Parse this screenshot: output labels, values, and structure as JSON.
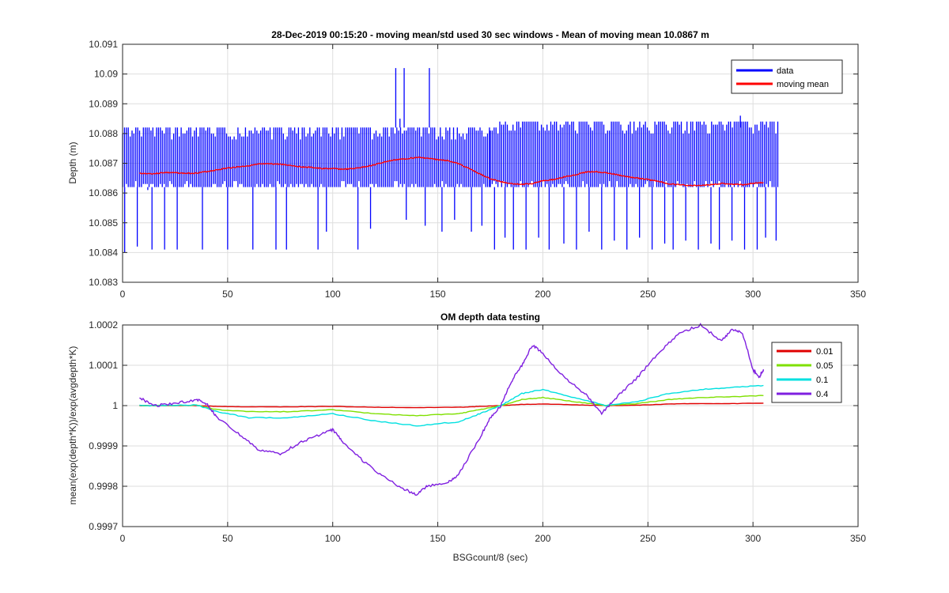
{
  "chart_data": [
    {
      "type": "line",
      "title": "28-Dec-2019 00:15:20 - moving mean/std used 30 sec windows - Mean of moving mean 10.0867 m",
      "xlabel": "",
      "ylabel": "Depth (m)",
      "xlim": [
        0,
        350
      ],
      "ylim": [
        10.083,
        10.091
      ],
      "x_ticks": [
        0,
        50,
        100,
        150,
        200,
        250,
        300,
        350
      ],
      "y_ticks": [
        10.083,
        10.084,
        10.085,
        10.086,
        10.087,
        10.088,
        10.089,
        10.09,
        10.091
      ],
      "y_tick_labels": [
        "10.083",
        "10.084",
        "10.085",
        "10.086",
        "10.087",
        "10.088",
        "10.089",
        "10.09",
        "10.091"
      ],
      "grid": true,
      "legend_position": "top-right",
      "series": [
        {
          "name": "data",
          "color": "#0000ff",
          "kind": "noisy-band",
          "x_range": [
            0,
            312
          ],
          "band_segments": [
            {
              "x": [
                0,
                175
              ],
              "low": 10.0862,
              "high": 10.0882
            },
            {
              "x": [
                175,
                312
              ],
              "low": 10.0862,
              "high": 10.0884
            }
          ],
          "spikes_down": [
            [
              1,
              10.084
            ],
            [
              7,
              10.0842
            ],
            [
              12,
              10.0861
            ],
            [
              14,
              10.0841
            ],
            [
              20,
              10.0841
            ],
            [
              26,
              10.0841
            ],
            [
              38,
              10.0841
            ],
            [
              50,
              10.0841
            ],
            [
              62,
              10.0841
            ],
            [
              73,
              10.0841
            ],
            [
              78,
              10.0841
            ],
            [
              93,
              10.0841
            ],
            [
              97,
              10.0847
            ],
            [
              112,
              10.0841
            ],
            [
              118,
              10.0848
            ],
            [
              135,
              10.0851
            ],
            [
              144,
              10.0849
            ],
            [
              152,
              10.0847
            ],
            [
              158,
              10.0851
            ],
            [
              166,
              10.0847
            ],
            [
              171,
              10.0849
            ],
            [
              177,
              10.0841
            ],
            [
              182,
              10.0845
            ],
            [
              186,
              10.0841
            ],
            [
              192,
              10.0841
            ],
            [
              198,
              10.0845
            ],
            [
              203,
              10.0841
            ],
            [
              210,
              10.0843
            ],
            [
              216,
              10.0841
            ],
            [
              222,
              10.0847
            ],
            [
              228,
              10.0841
            ],
            [
              234,
              10.0844
            ],
            [
              240,
              10.0841
            ],
            [
              246,
              10.0845
            ],
            [
              252,
              10.0841
            ],
            [
              258,
              10.0843
            ],
            [
              262,
              10.0841
            ],
            [
              268,
              10.0844
            ],
            [
              274,
              10.0841
            ],
            [
              280,
              10.0843
            ],
            [
              284,
              10.0841
            ],
            [
              290,
              10.0844
            ],
            [
              296,
              10.0841
            ],
            [
              302,
              10.0841
            ],
            [
              306,
              10.0845
            ],
            [
              311,
              10.0844
            ]
          ],
          "spikes_up": [
            [
              130,
              10.0902
            ],
            [
              134,
              10.0902
            ],
            [
              146,
              10.0902
            ],
            [
              132,
              10.0885
            ],
            [
              294,
              10.0886
            ]
          ]
        },
        {
          "name": "moving mean",
          "color": "#ff0000",
          "x": [
            8,
            15,
            20,
            25,
            30,
            35,
            40,
            45,
            50,
            55,
            60,
            65,
            70,
            75,
            80,
            85,
            90,
            95,
            100,
            105,
            110,
            115,
            120,
            125,
            130,
            135,
            140,
            145,
            150,
            155,
            160,
            165,
            170,
            175,
            180,
            185,
            190,
            195,
            200,
            205,
            210,
            215,
            220,
            225,
            230,
            235,
            240,
            245,
            250,
            255,
            260,
            265,
            270,
            275,
            280,
            285,
            290,
            295,
            300,
            305
          ],
          "y": [
            10.08666,
            10.08665,
            10.08669,
            10.08668,
            10.08666,
            10.08667,
            10.08672,
            10.08678,
            10.08684,
            10.08688,
            10.08692,
            10.08697,
            10.08698,
            10.08697,
            10.08693,
            10.08688,
            10.08686,
            10.08682,
            10.08682,
            10.0868,
            10.08682,
            10.08688,
            10.08695,
            10.08705,
            10.08712,
            10.08715,
            10.0872,
            10.08717,
            10.08712,
            10.08709,
            10.08698,
            10.08682,
            10.08664,
            10.08648,
            10.08638,
            10.08632,
            10.08629,
            10.08632,
            10.08642,
            10.08645,
            10.08654,
            10.0866,
            10.0867,
            10.08672,
            10.08668,
            10.08662,
            10.08655,
            10.0865,
            10.08645,
            10.0864,
            10.0863,
            10.08628,
            10.08625,
            10.08626,
            10.08628,
            10.08632,
            10.0863,
            10.08628,
            10.08632,
            10.08636
          ]
        }
      ]
    },
    {
      "type": "line",
      "title": "OM depth data testing",
      "xlabel": "BSGcount/8 (sec)",
      "ylabel": "mean(exp(depth*K))/exp(avgdepth*K)",
      "xlim": [
        0,
        350
      ],
      "ylim": [
        0.9997,
        1.0002
      ],
      "x_ticks": [
        0,
        50,
        100,
        150,
        200,
        250,
        300,
        350
      ],
      "y_ticks": [
        0.9997,
        0.9998,
        0.9999,
        1.0,
        1.0001,
        1.0002
      ],
      "y_tick_labels": [
        "0.9997",
        "0.9998",
        "0.9999",
        "1",
        "1.0001",
        "1.0002"
      ],
      "grid": true,
      "legend_position": "top-right",
      "series": [
        {
          "name": "0.01",
          "color": "#e00000",
          "x": [
            8,
            20,
            35,
            45,
            60,
            80,
            100,
            120,
            140,
            160,
            170,
            180,
            190,
            200,
            215,
            230,
            245,
            260,
            275,
            290,
            305
          ],
          "y": [
            1.0,
            1.0,
            1.0,
            0.999998,
            0.999997,
            0.999997,
            0.999998,
            0.999996,
            0.999995,
            0.999996,
            0.999998,
            1.0,
            1.000003,
            1.000004,
            1.000002,
            1.0,
            1.000001,
            1.000004,
            1.000005,
            1.000005,
            1.000006
          ]
        },
        {
          "name": "0.05",
          "color": "#7fe000",
          "x": [
            8,
            20,
            35,
            45,
            60,
            80,
            100,
            120,
            140,
            160,
            170,
            180,
            190,
            200,
            215,
            230,
            245,
            260,
            275,
            290,
            305
          ],
          "y": [
            1.0,
            1.0,
            1.000001,
            0.99999,
            0.999985,
            0.999985,
            0.99999,
            0.99998,
            0.999975,
            0.99998,
            0.99999,
            1.0,
            1.000015,
            1.00002,
            1.00001,
            1.0,
            1.000005,
            1.000015,
            1.00002,
            1.000022,
            1.000025
          ]
        },
        {
          "name": "0.1",
          "color": "#00e0e0",
          "x": [
            8,
            20,
            35,
            45,
            60,
            80,
            100,
            120,
            140,
            160,
            170,
            180,
            190,
            200,
            215,
            230,
            245,
            260,
            275,
            290,
            305
          ],
          "y": [
            1.0,
            1.0,
            1.000002,
            0.999985,
            0.99997,
            0.99997,
            0.99998,
            0.999962,
            0.99995,
            0.99996,
            0.99998,
            1.0,
            1.00003,
            1.00004,
            1.00002,
            1.0,
            1.00001,
            1.00003,
            1.00004,
            1.000045,
            1.00005
          ]
        },
        {
          "name": "0.4",
          "color": "#7f1fe0",
          "x": [
            8,
            15,
            25,
            35,
            40,
            45,
            55,
            65,
            75,
            85,
            95,
            100,
            105,
            115,
            125,
            135,
            140,
            145,
            155,
            160,
            170,
            175,
            180,
            185,
            190,
            195,
            200,
            210,
            220,
            228,
            235,
            245,
            255,
            265,
            275,
            285,
            290,
            295,
            300,
            303,
            305
          ],
          "y": [
            1.00002,
            1.0,
            1.000005,
            1.000015,
            1.000005,
            0.99997,
            0.99993,
            0.99989,
            0.99988,
            0.99991,
            0.99993,
            0.99994,
            0.99991,
            0.99986,
            0.99982,
            0.99979,
            0.99978,
            0.9998,
            0.99981,
            0.99983,
            0.99992,
            0.99997,
            1.0,
            1.00006,
            1.0001,
            1.00015,
            1.00013,
            1.00007,
            1.00003,
            0.99998,
            1.00002,
            1.00007,
            1.00013,
            1.00018,
            1.0002,
            1.00016,
            1.00019,
            1.00018,
            1.00009,
            1.00007,
            1.00009
          ]
        }
      ]
    }
  ]
}
